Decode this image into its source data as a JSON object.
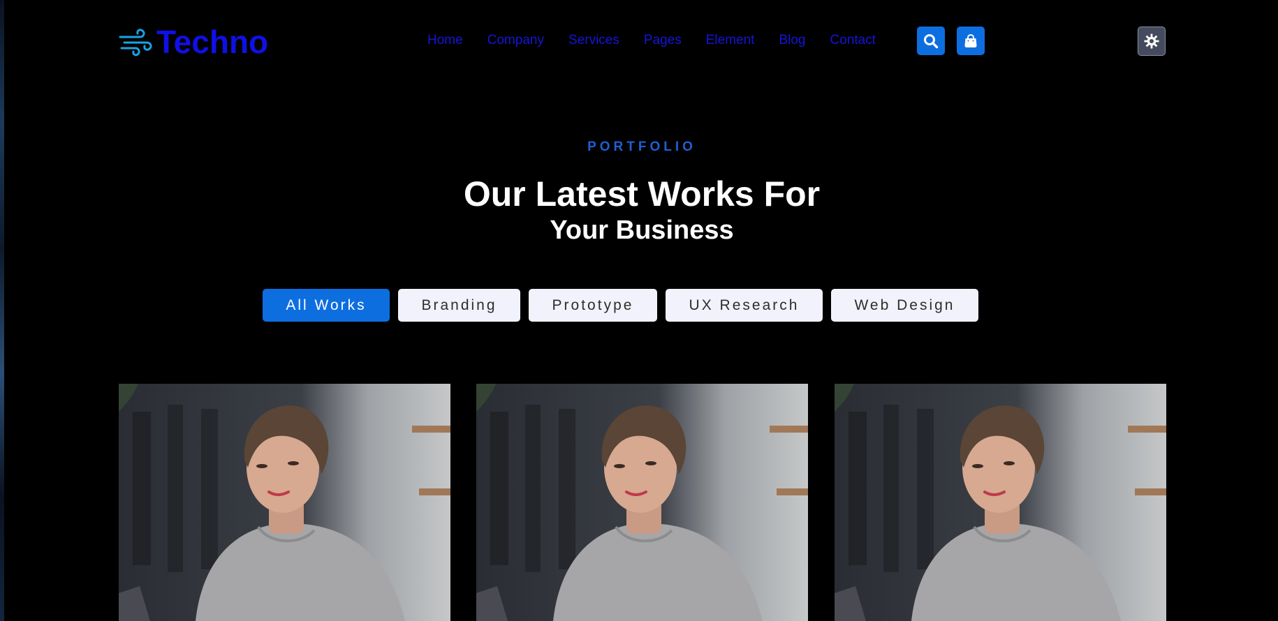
{
  "brand": {
    "name": "Techno",
    "accent": "#1010e6",
    "icon": "wind-icon"
  },
  "nav": {
    "items": [
      "Home",
      "Company",
      "Services",
      "Pages",
      "Element",
      "Blog",
      "Contact"
    ],
    "search_icon": "search-icon",
    "cart_icon": "shopping-bag-icon",
    "theme_icon": "sun-gear-icon"
  },
  "hero": {
    "eyebrow": "PORTFOLIO",
    "title_line1": "Our Latest Works For",
    "title_line2": "Your Business"
  },
  "filters": {
    "items": [
      "All Works",
      "Branding",
      "Prototype",
      "UX Research",
      "Web Design"
    ],
    "active": "All Works",
    "active_color": "#0d6ee0"
  },
  "portfolio": {
    "cards": [
      {
        "image": "woman-working-on-laptop-photo"
      },
      {
        "image": "woman-working-on-laptop-photo"
      },
      {
        "image": "woman-working-on-laptop-photo"
      }
    ]
  }
}
